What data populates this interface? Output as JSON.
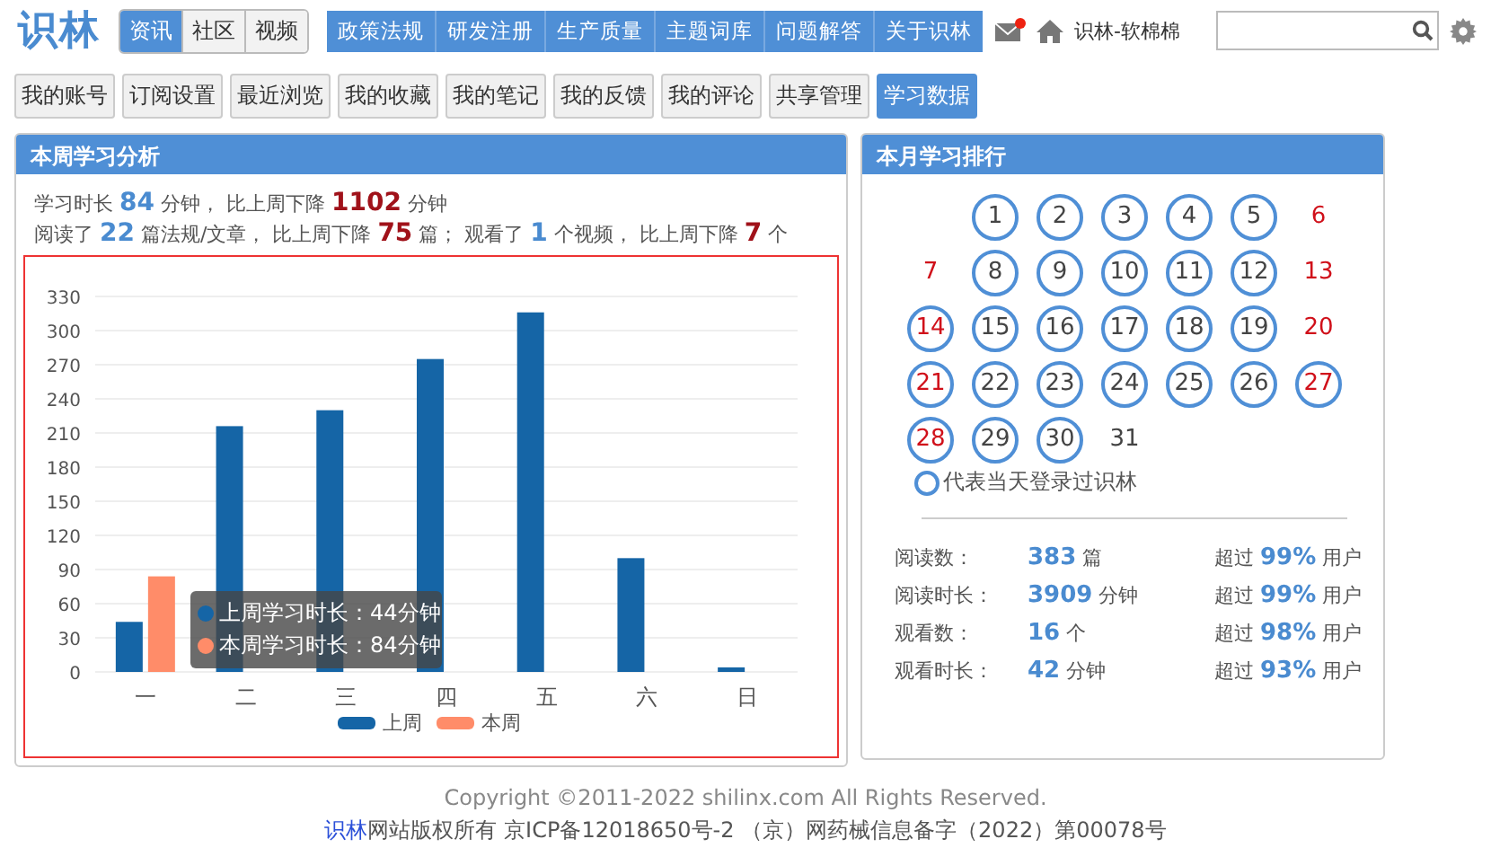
{
  "header": {
    "logo": "识林",
    "channel_tabs": [
      {
        "label": "资讯",
        "selected": true
      },
      {
        "label": "社区",
        "selected": false
      },
      {
        "label": "视频",
        "selected": false
      }
    ],
    "nav": [
      "政策法规",
      "研发注册",
      "生产质量",
      "主题词库",
      "问题解答",
      "关于识林"
    ],
    "mail_unread": true,
    "user": "识林-软棉棉"
  },
  "tabs": [
    {
      "label": "我的账号",
      "selected": false
    },
    {
      "label": "订阅设置",
      "selected": false
    },
    {
      "label": "最近浏览",
      "selected": false
    },
    {
      "label": "我的收藏",
      "selected": false
    },
    {
      "label": "我的笔记",
      "selected": false
    },
    {
      "label": "我的反馈",
      "selected": false
    },
    {
      "label": "我的评论",
      "selected": false
    },
    {
      "label": "共享管理",
      "selected": false
    },
    {
      "label": "学习数据",
      "selected": true
    }
  ],
  "weekly": {
    "title": "本周学习分析",
    "summary": [
      [
        {
          "kind": "plain",
          "text": "学习时长 "
        },
        {
          "kind": "current",
          "text": "84"
        },
        {
          "kind": "plain",
          "text": " 分钟， 比上周下降 "
        },
        {
          "kind": "decrease",
          "text": "1102"
        },
        {
          "kind": "plain",
          "text": " 分钟"
        }
      ],
      [
        {
          "kind": "plain",
          "text": "阅读了 "
        },
        {
          "kind": "current",
          "text": "22"
        },
        {
          "kind": "plain",
          "text": " 篇法规/文章， 比上周下降 "
        },
        {
          "kind": "decrease",
          "text": "75"
        },
        {
          "kind": "plain",
          "text": " 篇； 观看了 "
        },
        {
          "kind": "current",
          "text": "1"
        },
        {
          "kind": "plain",
          "text": " 个视频， 比上周下降 "
        },
        {
          "kind": "decrease",
          "text": "7"
        },
        {
          "kind": "plain",
          "text": " 个"
        }
      ]
    ],
    "chart_data": {
      "type": "bar",
      "categories": [
        "一",
        "二",
        "三",
        "四",
        "五",
        "六",
        "日"
      ],
      "series": [
        {
          "name": "上周",
          "color": "#1565a6",
          "values": [
            44,
            216,
            230,
            275,
            316,
            100,
            4
          ]
        },
        {
          "name": "本周",
          "color": "#ff8c69",
          "values": [
            84,
            null,
            null,
            null,
            null,
            null,
            null
          ]
        }
      ],
      "grid": true,
      "legend": "bottom",
      "ylim": [
        0,
        330
      ],
      "yticks": [
        0,
        30,
        60,
        90,
        120,
        150,
        180,
        210,
        240,
        270,
        300,
        330
      ]
    },
    "tooltip": [
      {
        "text": "上周学习时长：44分钟",
        "color": "#1565a6"
      },
      {
        "text": "本周学习时长：84分钟",
        "color": "#ff8c69"
      }
    ]
  },
  "monthly": {
    "title": "本月学习排行",
    "days": [
      {
        "day": "1",
        "logged_in": true,
        "weekend": false
      },
      {
        "day": "2",
        "logged_in": true,
        "weekend": false
      },
      {
        "day": "3",
        "logged_in": true,
        "weekend": false
      },
      {
        "day": "4",
        "logged_in": true,
        "weekend": false
      },
      {
        "day": "5",
        "logged_in": true,
        "weekend": false
      },
      {
        "day": "6",
        "logged_in": false,
        "weekend": true
      },
      {
        "day": "7",
        "logged_in": false,
        "weekend": true
      },
      {
        "day": "8",
        "logged_in": true,
        "weekend": false
      },
      {
        "day": "9",
        "logged_in": true,
        "weekend": false
      },
      {
        "day": "10",
        "logged_in": true,
        "weekend": false
      },
      {
        "day": "11",
        "logged_in": true,
        "weekend": false
      },
      {
        "day": "12",
        "logged_in": true,
        "weekend": false
      },
      {
        "day": "13",
        "logged_in": false,
        "weekend": true
      },
      {
        "day": "14",
        "logged_in": true,
        "weekend": true
      },
      {
        "day": "15",
        "logged_in": true,
        "weekend": false
      },
      {
        "day": "16",
        "logged_in": true,
        "weekend": false
      },
      {
        "day": "17",
        "logged_in": true,
        "weekend": false
      },
      {
        "day": "18",
        "logged_in": true,
        "weekend": false
      },
      {
        "day": "19",
        "logged_in": true,
        "weekend": false
      },
      {
        "day": "20",
        "logged_in": false,
        "weekend": true
      },
      {
        "day": "21",
        "logged_in": true,
        "weekend": true
      },
      {
        "day": "22",
        "logged_in": true,
        "weekend": false
      },
      {
        "day": "23",
        "logged_in": true,
        "weekend": false
      },
      {
        "day": "24",
        "logged_in": true,
        "weekend": false
      },
      {
        "day": "25",
        "logged_in": true,
        "weekend": false
      },
      {
        "day": "26",
        "logged_in": true,
        "weekend": false
      },
      {
        "day": "27",
        "logged_in": true,
        "weekend": true
      },
      {
        "day": "28",
        "logged_in": true,
        "weekend": true
      },
      {
        "day": "29",
        "logged_in": true,
        "weekend": false
      },
      {
        "day": "30",
        "logged_in": true,
        "weekend": false
      },
      {
        "day": "31",
        "logged_in": false,
        "weekend": false
      }
    ],
    "legend": "代表当天登录过识林",
    "stats": [
      {
        "label": "阅读数：",
        "value": "383",
        "unit": "篇",
        "prefix": "超过",
        "rank": "99%",
        "suffix": "用户"
      },
      {
        "label": "阅读时长：",
        "value": "3909",
        "unit": "分钟",
        "prefix": "超过",
        "rank": "99%",
        "suffix": "用户"
      },
      {
        "label": "观看数：",
        "value": "16",
        "unit": "个",
        "prefix": "超过",
        "rank": "98%",
        "suffix": "用户"
      },
      {
        "label": "观看时长：",
        "value": "42",
        "unit": "分钟",
        "prefix": "超过",
        "rank": "93%",
        "suffix": "用户"
      }
    ]
  },
  "footer": {
    "copyright": "Copyright ©2011-2022 shilinx.com All Rights Reserved.",
    "owner_link": "识林",
    "license": "网站版权所有 京ICP备12018650号-2 （京）网药械信息备字（2022）第00078号"
  }
}
